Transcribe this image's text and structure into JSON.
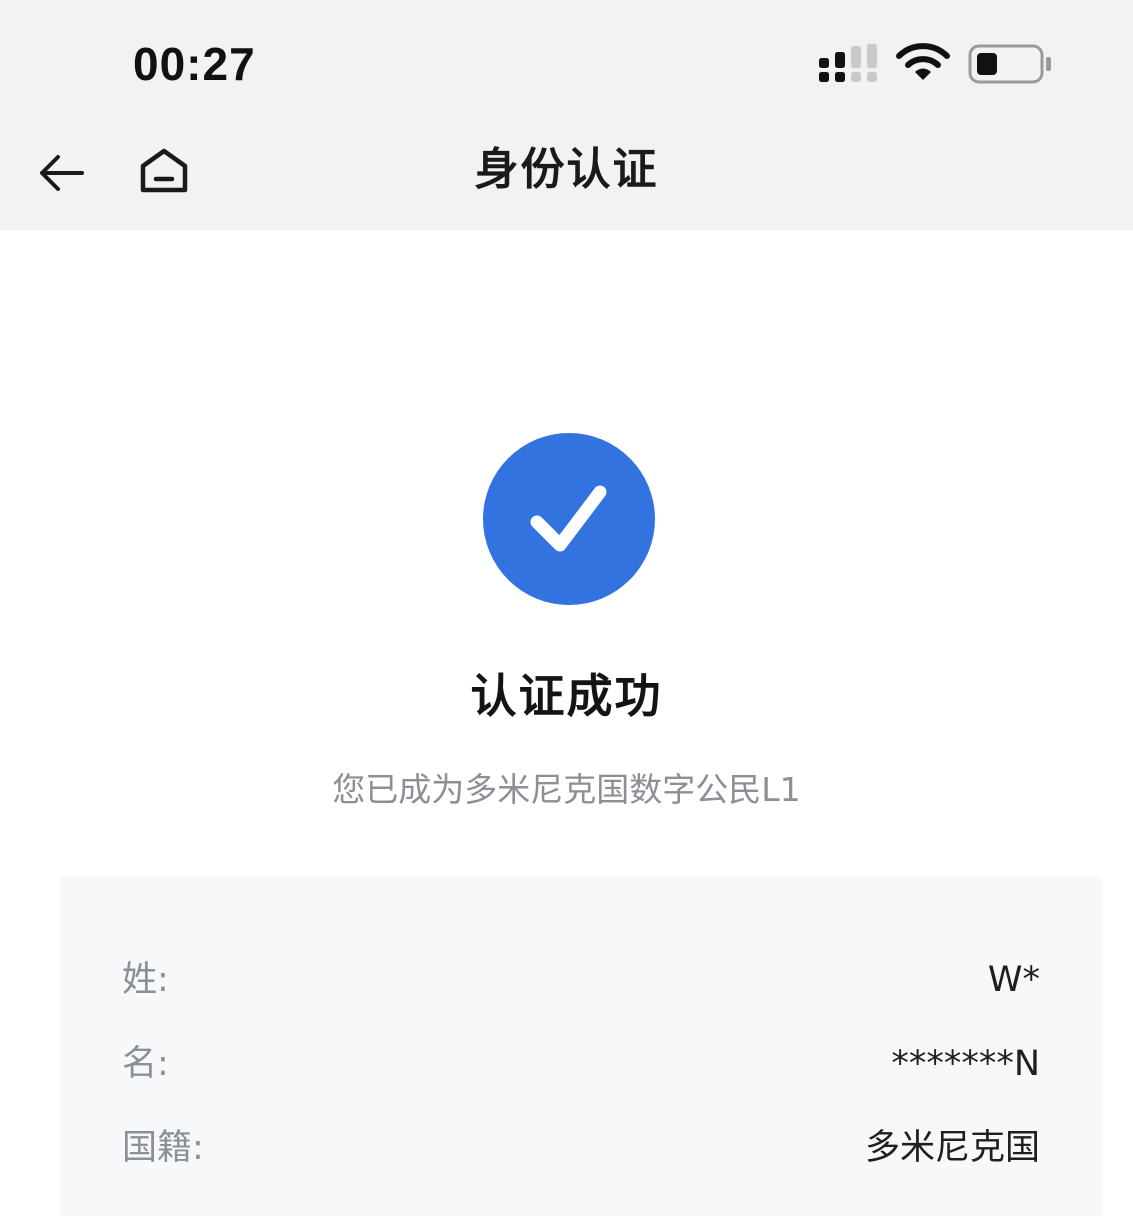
{
  "status_bar": {
    "time": "00:27",
    "icons": [
      "cellular-signal-icon",
      "wifi-icon",
      "battery-icon"
    ]
  },
  "nav": {
    "title": "身份认证",
    "back_icon": "arrow-left-icon",
    "home_icon": "home-icon"
  },
  "result": {
    "icon": "check-circle-icon",
    "title": "认证成功",
    "subtitle": "您已成为多米尼克国数字公民L1"
  },
  "info": {
    "rows": [
      {
        "label": "姓:",
        "value": "W*"
      },
      {
        "label": "名:",
        "value": "*******N"
      },
      {
        "label": "国籍:",
        "value": "多米尼克国"
      }
    ]
  },
  "colors": {
    "accent": "#3273e0",
    "nav_bg": "#f2f2f2",
    "card_bg": "#f7f8fa",
    "muted_text": "#8b8f96"
  }
}
